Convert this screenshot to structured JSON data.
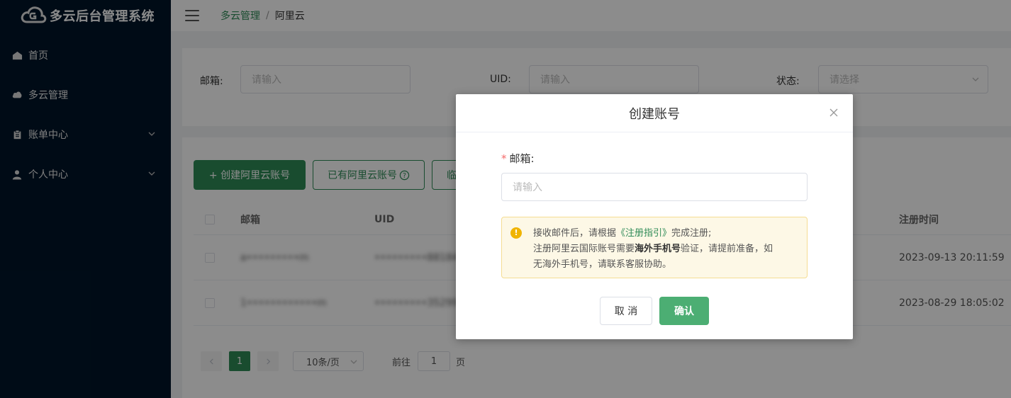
{
  "app": {
    "title": "多云后台管理系统"
  },
  "sidebar": {
    "items": [
      {
        "label": "首页",
        "icon": "home-icon"
      },
      {
        "label": "多云管理",
        "icon": "cloud-icon"
      },
      {
        "label": "账单中心",
        "icon": "clipboard-icon",
        "expandable": true
      },
      {
        "label": "个人中心",
        "icon": "user-icon",
        "expandable": true
      }
    ]
  },
  "breadcrumb": {
    "parent": "多云管理",
    "separator": "/",
    "current": "阿里云"
  },
  "filters": {
    "email_label": "邮箱:",
    "email_placeholder": "请输入",
    "uid_label": "UID:",
    "uid_placeholder": "请输入",
    "status_label": "状态:",
    "status_placeholder": "请选择"
  },
  "toolbar": {
    "create_label": "+ 创建阿里云账号",
    "existing_label": "已有阿里云账号",
    "third_label": "临"
  },
  "table": {
    "headers": [
      "邮箱",
      "UID",
      "注册时间"
    ],
    "rows": [
      {
        "email": "a•••••••••m",
        "uid": "•••••••••88184",
        "registered": "2023-09-13 20:11:59"
      },
      {
        "email": "1••••••••••••m",
        "uid": "•••••••••35299",
        "registered": "2023-08-29 18:05:02"
      }
    ]
  },
  "pagination": {
    "current_page": "1",
    "page_size": "10条/页",
    "goto_label": "前往",
    "goto_value": "1",
    "page_suffix": "页"
  },
  "modal": {
    "title": "创建账号",
    "email_label": "邮箱:",
    "required_mark": "*",
    "email_placeholder": "请输入",
    "notice": {
      "line1_prefix": "接收邮件后，请根据",
      "line1_link": "《注册指引》",
      "line1_suffix": "完成注册;",
      "line2_prefix": "注册阿里云国际账号需要",
      "line2_bold": "海外手机号",
      "line2_suffix": "验证，请提前准备，如",
      "line3": "无海外手机号，请联系客服协助。"
    },
    "cancel_label": "取 消",
    "confirm_label": "确认"
  },
  "colors": {
    "sidebar_bg": "#001529",
    "primary": "#2e8b57",
    "confirm": "#4cae73",
    "warning": "#f0b400",
    "notice_bg": "#fdf8e6"
  }
}
